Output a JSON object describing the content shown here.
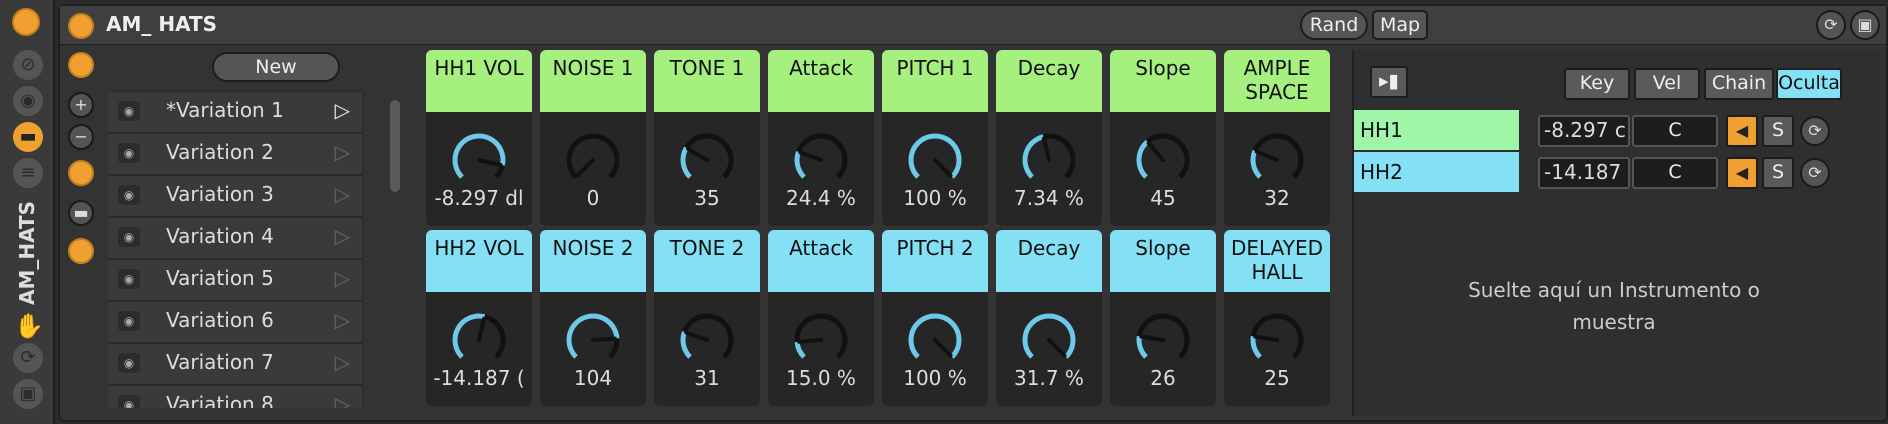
{
  "device": {
    "title": "AM_ HATS",
    "rand_label": "Rand",
    "map_label": "Map"
  },
  "rail": {
    "vertical_title": "AM_HATS"
  },
  "variations": {
    "new_label": "New",
    "items": [
      {
        "label": "*Variation 1",
        "active": true
      },
      {
        "label": "Variation 2"
      },
      {
        "label": "Variation 3"
      },
      {
        "label": "Variation 4"
      },
      {
        "label": "Variation 5"
      },
      {
        "label": "Variation 6"
      },
      {
        "label": "Variation 7"
      },
      {
        "label": "Variation 8"
      }
    ]
  },
  "macros": {
    "row1": [
      {
        "label": "HH1 VOL",
        "value": "-8.297 dl",
        "level": 0.88
      },
      {
        "label": "NOISE 1",
        "value": "0",
        "level": 0.0
      },
      {
        "label": "TONE 1",
        "value": "35",
        "level": 0.28
      },
      {
        "label": "Attack",
        "value": "24.4 %",
        "level": 0.24
      },
      {
        "label": "PITCH 1",
        "value": "100 %",
        "level": 1.0
      },
      {
        "label": "Decay",
        "value": "7.34 %",
        "level": 0.45
      },
      {
        "label": "Slope",
        "value": "45",
        "level": 0.35
      },
      {
        "label": "AMPLE\nSPACE",
        "value": "32",
        "level": 0.25
      }
    ],
    "row2": [
      {
        "label": "HH2 VOL",
        "value": "-14.187 (",
        "level": 0.55
      },
      {
        "label": "NOISE 2",
        "value": "104",
        "level": 0.82
      },
      {
        "label": "TONE 2",
        "value": "31",
        "level": 0.24
      },
      {
        "label": "Attack",
        "value": "15.0 %",
        "level": 0.15
      },
      {
        "label": "PITCH 2",
        "value": "100 %",
        "level": 1.0
      },
      {
        "label": "Decay",
        "value": "31.7 %",
        "level": 1.0
      },
      {
        "label": "Slope",
        "value": "26",
        "level": 0.2
      },
      {
        "label": "DELAYED\nHALL",
        "value": "25",
        "level": 0.2
      }
    ]
  },
  "chains": {
    "header_buttons": {
      "key": "Key",
      "vel": "Vel",
      "chain": "Chain",
      "hide": "Oculta"
    },
    "rows": [
      {
        "name": "HH1",
        "volume": "-8.297 c",
        "key": "C",
        "solo": "S",
        "color": "#9ff5a8"
      },
      {
        "name": "HH2",
        "volume": "-14.187",
        "key": "C",
        "solo": "S",
        "color": "#84e0f5"
      }
    ],
    "drop_text": "Suelte aquí un Instrumento o muestra"
  },
  "colors": {
    "accent_orange": "#f0a030",
    "knob_arc": "#6ec8e8",
    "green_macro": "#a5f07f",
    "blue_macro": "#84e0f5"
  }
}
